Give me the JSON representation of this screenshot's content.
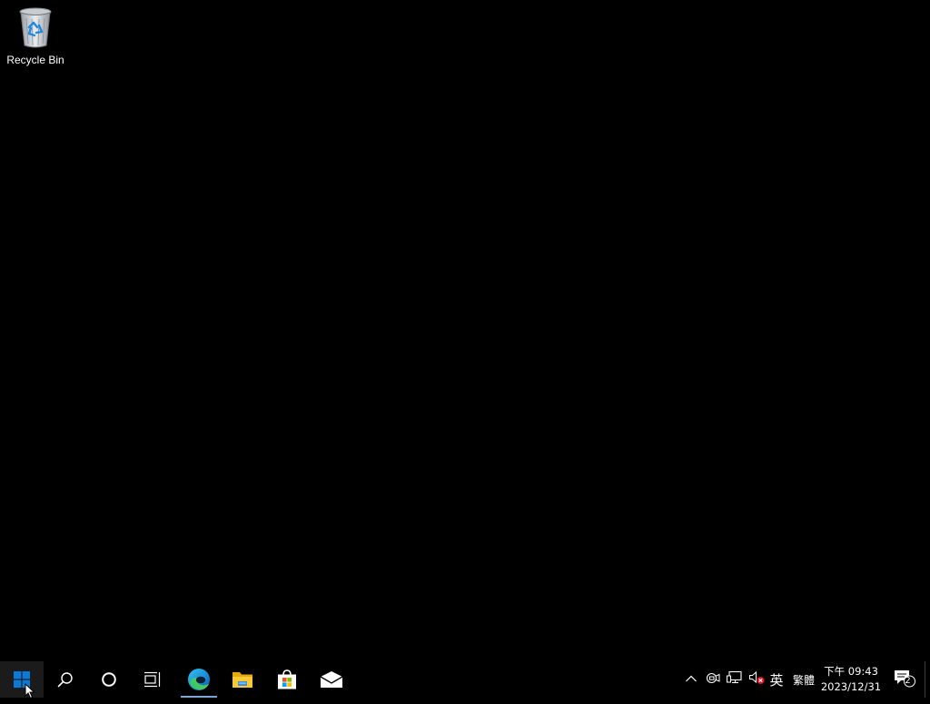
{
  "desktop": {
    "background_color": "#000000",
    "icons": [
      {
        "label": "Recycle Bin",
        "icon": "recycle-bin-icon"
      }
    ]
  },
  "taskbar": {
    "start_icon": "windows-logo-icon",
    "search_icon": "search-icon",
    "cortana_icon": "cortana-circle-icon",
    "task_view_icon": "task-view-icon",
    "pinned_apps": [
      {
        "name": "edge",
        "icon": "edge-icon",
        "active": true
      },
      {
        "name": "file-explorer",
        "icon": "folder-icon",
        "active": false
      },
      {
        "name": "store",
        "icon": "store-bag-icon",
        "active": false
      },
      {
        "name": "mail",
        "icon": "mail-icon",
        "active": false
      }
    ],
    "tray": {
      "chevron_icon": "chevron-up-icon",
      "meet_icon": "meet-now-icon",
      "network_icon": "network-icon",
      "volume_icon": "volume-muted-icon",
      "ime_language": "英",
      "ime_mode": "繁體",
      "time": "下午 09:43",
      "date": "2023/12/31",
      "notification_count": "2"
    },
    "accent_color": "#0078d7"
  }
}
